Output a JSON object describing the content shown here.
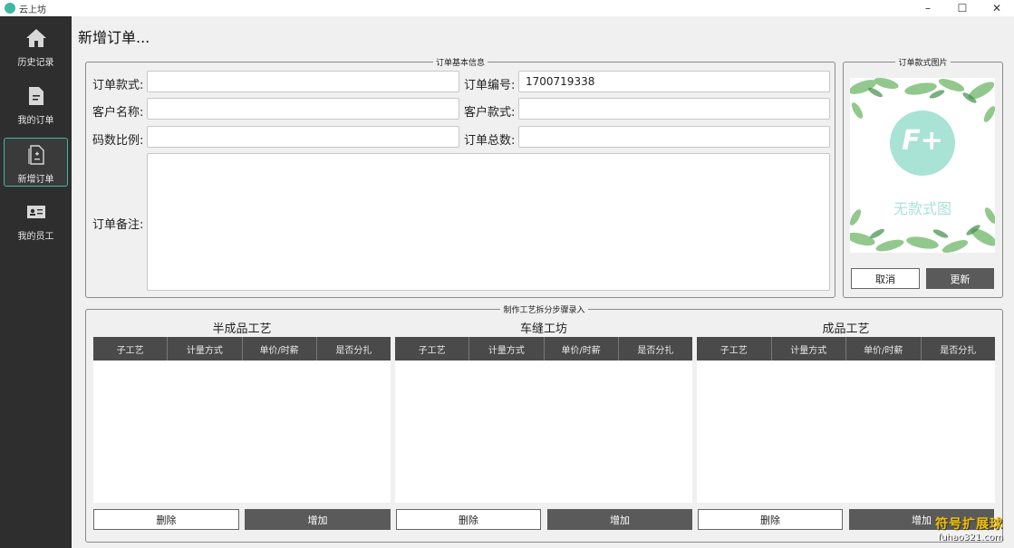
{
  "window": {
    "title": "云上坊",
    "minimize": "–",
    "maximize": "☐",
    "close": "✕"
  },
  "sidebar": {
    "items": [
      {
        "label": "历史记录",
        "icon": "home-icon"
      },
      {
        "label": "我的订单",
        "icon": "document-icon"
      },
      {
        "label": "新增订单",
        "icon": "new-document-icon",
        "active": true
      },
      {
        "label": "我的员工",
        "icon": "id-card-icon"
      }
    ]
  },
  "page": {
    "title": "新增订单..."
  },
  "basic_info": {
    "legend": "订单基本信息",
    "style_label": "订单款式:",
    "style_value": "",
    "order_no_label": "订单编号:",
    "order_no_value": "1700719338",
    "customer_label": "客户名称:",
    "customer_value": "",
    "customer_style_label": "客户款式:",
    "customer_style_value": "",
    "size_ratio_label": "码数比例:",
    "size_ratio_value": "",
    "total_label": "订单总数:",
    "total_value": "",
    "remarks_label": "订单备注:",
    "remarks_value": ""
  },
  "style_image": {
    "legend": "订单款式图片",
    "no_image_text": "无款式图",
    "logo_text": "F+",
    "cancel_label": "取消",
    "update_label": "更新"
  },
  "process": {
    "legend": "制作工艺拆分步骤录入",
    "columns": [
      "子工艺",
      "计量方式",
      "单价/时薪",
      "是否分扎"
    ],
    "sections": [
      {
        "title": "半成品工艺",
        "delete_label": "删除",
        "add_label": "增加"
      },
      {
        "title": "车缝工坊",
        "delete_label": "删除",
        "add_label": "增加"
      },
      {
        "title": "成品工艺",
        "delete_label": "删除",
        "add_label": "增加"
      }
    ]
  },
  "watermark": {
    "line1": "符号扩展球",
    "line2": "fuhao321.com"
  },
  "colors": {
    "accent": "#3fb8a0",
    "sidebar": "#2e2e2e",
    "table_header": "#4a4a4a",
    "dark_button": "#5a5a5a"
  }
}
